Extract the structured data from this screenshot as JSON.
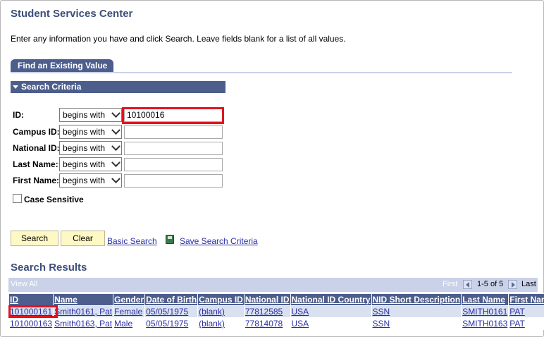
{
  "page": {
    "title": "Student Services Center",
    "instructions": "Enter any information you have and click Search. Leave fields blank for a list of all values."
  },
  "tab": {
    "label": "Find an Existing Value"
  },
  "search_criteria": {
    "header": "Search Criteria",
    "fields": [
      {
        "label": "ID:",
        "operator": "begins with",
        "value": "10100016"
      },
      {
        "label": "Campus ID:",
        "operator": "begins with",
        "value": ""
      },
      {
        "label": "National ID:",
        "operator": "begins with",
        "value": ""
      },
      {
        "label": "Last Name:",
        "operator": "begins with",
        "value": ""
      },
      {
        "label": "First Name:",
        "operator": "begins with",
        "value": ""
      }
    ],
    "case_sensitive_label": "Case Sensitive",
    "case_sensitive_checked": false
  },
  "actions": {
    "search": "Search",
    "clear": "Clear",
    "basic_search": "Basic Search",
    "save_search_criteria": "Save Search Criteria"
  },
  "results": {
    "title": "Search Results",
    "view_all": "View All",
    "first": "First",
    "count": "1-5 of 5",
    "last": "Last",
    "columns": [
      "ID",
      "Name",
      "Gender",
      "Date of Birth",
      "Campus ID",
      "National ID",
      "National ID Country",
      "NID Short Description",
      "Last Name",
      "First Name"
    ],
    "rows": [
      [
        "101000161",
        "Smith0161, Pat",
        "Female",
        "05/05/1975",
        "(blank)",
        "77812585",
        "USA",
        "SSN",
        "SMITH0161",
        "PAT"
      ],
      [
        "101000163",
        "Smith0163, Pat",
        "Male",
        "05/05/1975",
        "(blank)",
        "77814078",
        "USA",
        "SSN",
        "SMITH0163",
        "PAT"
      ]
    ]
  },
  "colors": {
    "header_blue": "#4d5d8c",
    "title_blue": "#3c4f7a",
    "highlight_red": "#e0141e",
    "button_yellow": "#fdf8c4",
    "row_alt": "#d9e1f0"
  },
  "icons": {
    "save": "save-criteria-icon",
    "collapse": "triangle-down-icon",
    "prev": "prev-arrow-icon",
    "next": "next-arrow-icon"
  }
}
